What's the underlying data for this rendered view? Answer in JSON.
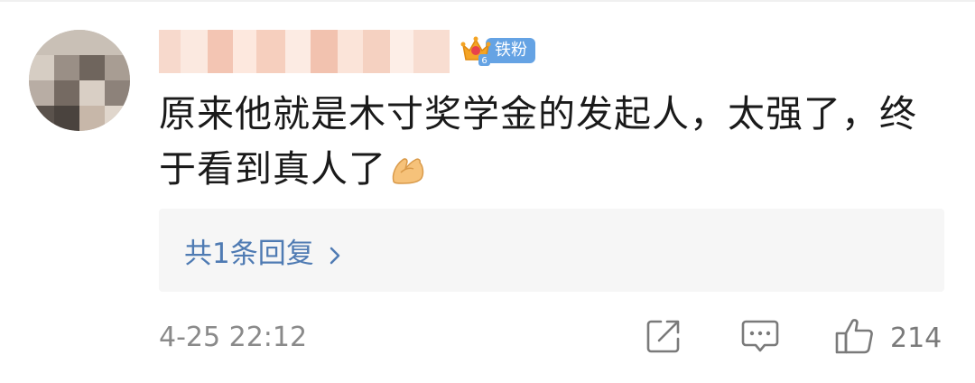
{
  "comment": {
    "user": {
      "name_redacted": true,
      "badge_level": "6",
      "badge_label": "铁粉"
    },
    "text": "原来他就是木寸奖学金的发起人，太强了，终于看到真人了",
    "emoji": "pinched-hands-emoji",
    "reply_summary": "共1条回复",
    "timestamp": "4-25 22:12",
    "actions": {
      "share_icon": "share-icon",
      "comment_icon": "comment-icon",
      "like_icon": "thumbs-up-icon",
      "like_count": "214"
    }
  },
  "colors": {
    "badge_blue": "#65a3e4",
    "link_blue": "#4f7bb3",
    "reply_bg": "#f6f6f6",
    "meta_gray": "#8a8a8a"
  }
}
